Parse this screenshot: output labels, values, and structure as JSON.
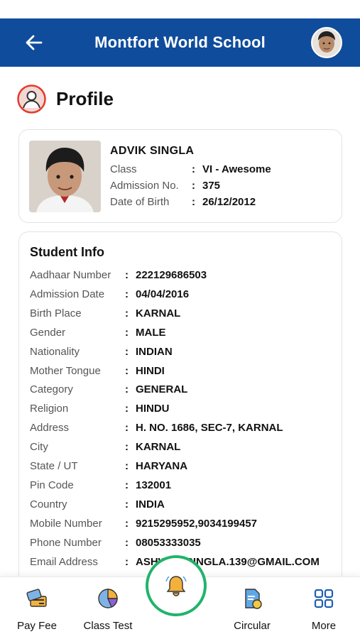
{
  "app": {
    "title": "Montfort World School",
    "accent": "#0f4c9c"
  },
  "page": {
    "title": "Profile"
  },
  "student": {
    "name": "ADVIK SINGLA",
    "fields": [
      {
        "label": "Class",
        "value": "VI - Awesome"
      },
      {
        "label": "Admission No.",
        "value": "375"
      },
      {
        "label": "Date of Birth",
        "value": "26/12/2012"
      }
    ]
  },
  "student_info": {
    "title": "Student Info",
    "rows": [
      {
        "label": "Aadhaar Number",
        "value": "222129686503"
      },
      {
        "label": "Admission Date",
        "value": "04/04/2016"
      },
      {
        "label": "Birth Place",
        "value": "KARNAL"
      },
      {
        "label": "Gender",
        "value": "MALE"
      },
      {
        "label": "Nationality",
        "value": "INDIAN"
      },
      {
        "label": "Mother Tongue",
        "value": "HINDI"
      },
      {
        "label": "Category",
        "value": "GENERAL"
      },
      {
        "label": "Religion",
        "value": "HINDU"
      },
      {
        "label": "Address",
        "value": "H. NO. 1686, SEC-7, KARNAL"
      },
      {
        "label": "City",
        "value": "KARNAL"
      },
      {
        "label": "State / UT",
        "value": "HARYANA"
      },
      {
        "label": "Pin Code",
        "value": "132001"
      },
      {
        "label": "Country",
        "value": "INDIA"
      },
      {
        "label": "Mobile Number",
        "value": "9215295952,9034199457"
      },
      {
        "label": "Phone Number",
        "value": "08053333035"
      },
      {
        "label": "Email Address",
        "value": "ASHWANISINGLA.139@GMAIL.COM"
      }
    ],
    "colon": ":"
  },
  "bottom_nav": {
    "items": [
      {
        "label": "Pay Fee",
        "icon": "pay-fee-icon"
      },
      {
        "label": "Class Test",
        "icon": "class-test-icon"
      },
      {
        "label": "Circular",
        "icon": "circular-icon"
      },
      {
        "label": "More",
        "icon": "more-grid-icon"
      }
    ],
    "center_icon": "bell-icon",
    "center_ring_color": "#22b36b"
  }
}
